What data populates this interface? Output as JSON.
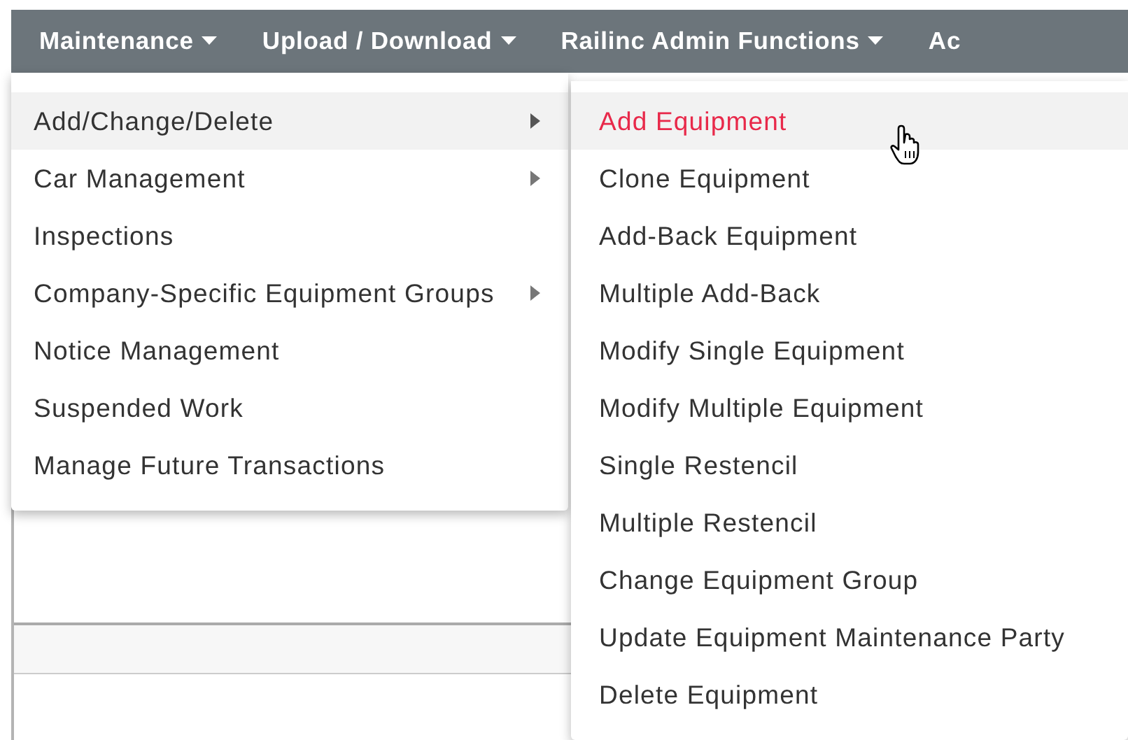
{
  "menubar": [
    {
      "label": "Maintenance",
      "dropdown": true
    },
    {
      "label": "Upload / Download",
      "dropdown": true
    },
    {
      "label": "Railinc Admin Functions",
      "dropdown": true
    },
    {
      "label": "Ac",
      "dropdown": false
    }
  ],
  "menu": [
    {
      "label": "Add/Change/Delete",
      "submenu": true,
      "selected": true
    },
    {
      "label": "Car Management",
      "submenu": true,
      "selected": false
    },
    {
      "label": "Inspections",
      "submenu": false,
      "selected": false
    },
    {
      "label": "Company-Specific Equipment Groups",
      "submenu": true,
      "selected": false
    },
    {
      "label": "Notice Management",
      "submenu": false,
      "selected": false
    },
    {
      "label": "Suspended Work",
      "submenu": false,
      "selected": false
    },
    {
      "label": "Manage Future Transactions",
      "submenu": false,
      "selected": false
    }
  ],
  "submenu": [
    {
      "label": "Add Equipment",
      "selected": true
    },
    {
      "label": "Clone Equipment",
      "selected": false
    },
    {
      "label": "Add-Back Equipment",
      "selected": false
    },
    {
      "label": "Multiple Add-Back",
      "selected": false
    },
    {
      "label": "Modify Single Equipment",
      "selected": false
    },
    {
      "label": "Modify Multiple Equipment",
      "selected": false
    },
    {
      "label": "Single Restencil",
      "selected": false
    },
    {
      "label": "Multiple Restencil",
      "selected": false
    },
    {
      "label": "Change Equipment Group",
      "selected": false
    },
    {
      "label": "Update Equipment Maintenance Party",
      "selected": false
    },
    {
      "label": "Delete Equipment",
      "selected": false
    }
  ]
}
